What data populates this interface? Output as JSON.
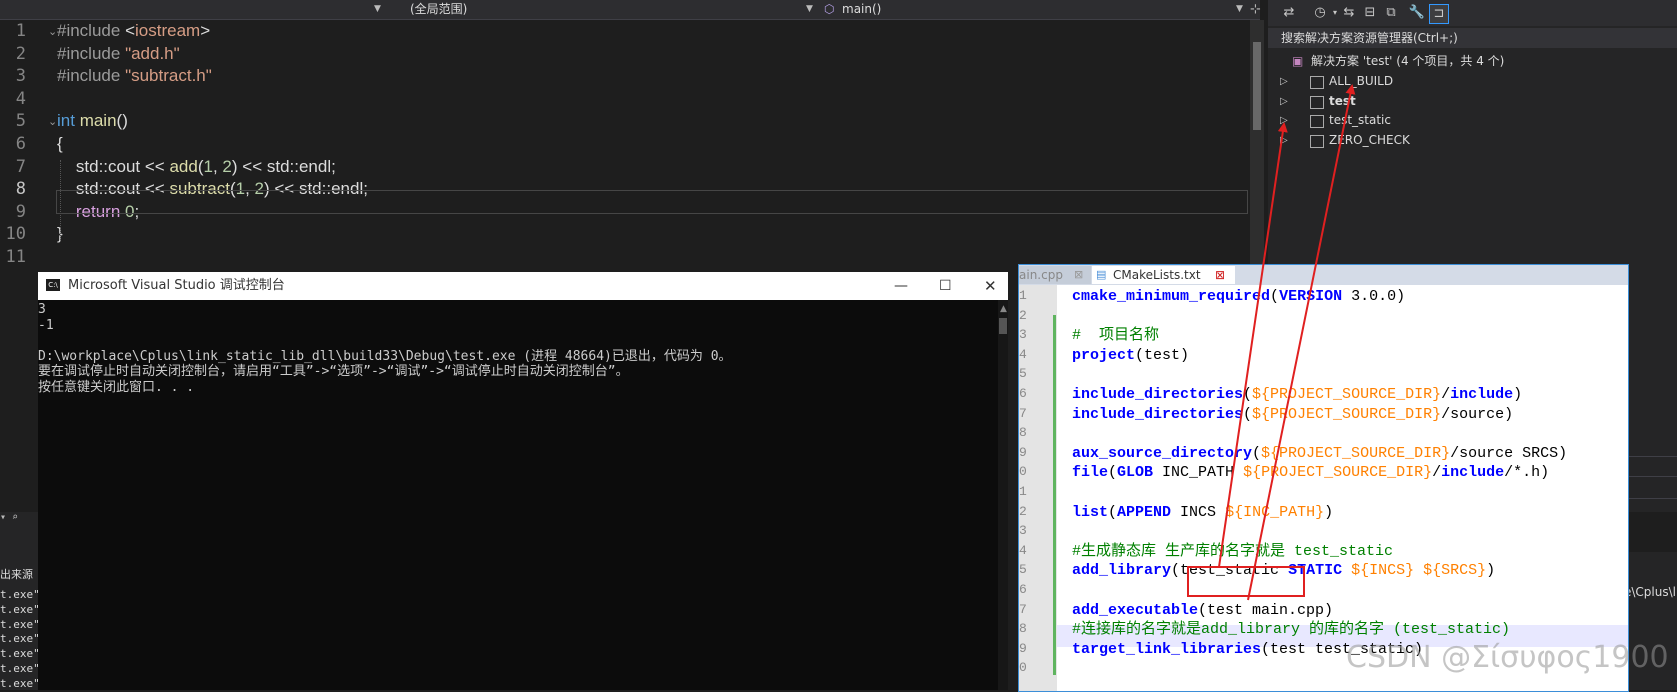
{
  "editor": {
    "nav": {
      "scope": "(全局范围)",
      "function": "main()"
    },
    "lines": [
      {
        "n": "1",
        "parts": [
          [
            "inc",
            "#include "
          ],
          [
            "txt",
            "<"
          ],
          [
            "str",
            "iostream"
          ],
          [
            "txt",
            ">"
          ]
        ]
      },
      {
        "n": "2",
        "parts": [
          [
            "inc",
            "#include "
          ],
          [
            "str",
            "\"add.h\""
          ]
        ]
      },
      {
        "n": "3",
        "parts": [
          [
            "inc",
            "#include "
          ],
          [
            "str",
            "\"subtract.h\""
          ]
        ]
      },
      {
        "n": "4",
        "parts": []
      },
      {
        "n": "5",
        "parts": [
          [
            "kw",
            "int "
          ],
          [
            "fn",
            "main"
          ],
          [
            "txt",
            "()"
          ]
        ]
      },
      {
        "n": "6",
        "parts": [
          [
            "txt",
            "{"
          ]
        ]
      },
      {
        "n": "7",
        "parts": [
          [
            "txt",
            "    std::cout << "
          ],
          [
            "fn",
            "add"
          ],
          [
            "txt",
            "("
          ],
          [
            "num",
            "1"
          ],
          [
            "txt",
            ", "
          ],
          [
            "num",
            "2"
          ],
          [
            "txt",
            ") << std::endl;"
          ]
        ]
      },
      {
        "n": "8",
        "parts": [
          [
            "txt",
            "    std::cout << "
          ],
          [
            "fn",
            "subtract"
          ],
          [
            "txt",
            "("
          ],
          [
            "num",
            "1"
          ],
          [
            "txt",
            ", "
          ],
          [
            "num",
            "2"
          ],
          [
            "txt",
            ") << std::endl;"
          ]
        ]
      },
      {
        "n": "9",
        "parts": [
          [
            "kw2",
            "    return "
          ],
          [
            "num",
            "0"
          ],
          [
            "txt",
            ";"
          ]
        ]
      },
      {
        "n": "10",
        "parts": [
          [
            "txt",
            "}"
          ]
        ]
      },
      {
        "n": "11",
        "parts": []
      }
    ]
  },
  "solution_explorer": {
    "search_placeholder": "搜索解决方案资源管理器(Ctrl+;)",
    "solution_label": "解决方案 'test' (4 个项目，共 4 个)",
    "projects": [
      "ALL_BUILD",
      "test",
      "test_static",
      "ZERO_CHECK"
    ],
    "right_fragment": "e\\Cplus\\li"
  },
  "console": {
    "title": "Microsoft Visual Studio 调试控制台",
    "output": [
      "3",
      "-1",
      "",
      "D:\\workplace\\Cplus\\link_static_lib_dll\\build33\\Debug\\test.exe (进程 48664)已退出，代码为 0。",
      "要在调试停止时自动关闭控制台，请启用“工具”->“选项”->“调试”->“调试停止时自动关闭控制台”。",
      "按任意键关闭此窗口. . ."
    ]
  },
  "notepad": {
    "tabs": [
      "ain.cpp",
      "CMakeLists.txt"
    ],
    "line_numbers": [
      "1",
      "2",
      "3",
      "4",
      "5",
      "6",
      "7",
      "8",
      "9",
      "0",
      "1",
      "2",
      "3",
      "4",
      "5",
      "6",
      "7",
      "8",
      "9",
      "0"
    ],
    "lines": [
      [
        [
          "kwb",
          "cmake_minimum_required"
        ],
        [
          "txt",
          "("
        ],
        [
          "kwb",
          "VERSION"
        ],
        [
          "txt",
          " 3.0.0)"
        ]
      ],
      [],
      [
        [
          "cm",
          "#  项目名称"
        ]
      ],
      [
        [
          "kwb",
          "project"
        ],
        [
          "txt",
          "(test)"
        ]
      ],
      [],
      [
        [
          "kwb",
          "include_directories"
        ],
        [
          "txt",
          "("
        ],
        [
          "var",
          "${PROJECT_SOURCE_DIR}"
        ],
        [
          "txt",
          "/"
        ],
        [
          "kwb",
          "include"
        ],
        [
          "txt",
          ")"
        ]
      ],
      [
        [
          "kwb",
          "include_directories"
        ],
        [
          "txt",
          "("
        ],
        [
          "var",
          "${PROJECT_SOURCE_DIR}"
        ],
        [
          "txt",
          "/source)"
        ]
      ],
      [],
      [
        [
          "kwb",
          "aux_source_directory"
        ],
        [
          "txt",
          "("
        ],
        [
          "var",
          "${PROJECT_SOURCE_DIR}"
        ],
        [
          "txt",
          "/source SRCS)"
        ]
      ],
      [
        [
          "kwb",
          "file"
        ],
        [
          "txt",
          "("
        ],
        [
          "kwb",
          "GLOB"
        ],
        [
          "txt",
          " INC_PATH "
        ],
        [
          "var",
          "${PROJECT_SOURCE_DIR}"
        ],
        [
          "txt",
          "/"
        ],
        [
          "kwb",
          "include"
        ],
        [
          "txt",
          "/*.h)"
        ]
      ],
      [],
      [
        [
          "kwb",
          "list"
        ],
        [
          "txt",
          "("
        ],
        [
          "kwb",
          "APPEND"
        ],
        [
          "txt",
          " INCS "
        ],
        [
          "var",
          "${INC_PATH}"
        ],
        [
          "txt",
          ")"
        ]
      ],
      [],
      [
        [
          "cm",
          "#生成静态库 生产库的名字就是 test_static"
        ]
      ],
      [
        [
          "kwb",
          "add_library"
        ],
        [
          "txt",
          "(test_static "
        ],
        [
          "kwb",
          "STATIC"
        ],
        [
          "txt",
          " "
        ],
        [
          "var",
          "${INCS} ${SRCS}"
        ],
        [
          "txt",
          ")"
        ]
      ],
      [],
      [
        [
          "kwb",
          "add_executable"
        ],
        [
          "txt",
          "(test main.cpp)"
        ]
      ],
      [
        [
          "cm",
          "#连接库的名字就是add_library 的库的名字 (test_static)"
        ]
      ],
      [
        [
          "kwb",
          "target_link_libraries"
        ],
        [
          "txt",
          "(test test_static)"
        ]
      ],
      []
    ]
  },
  "left_fragment": {
    "label": "出来源",
    "rows": [
      "t.exe\"",
      "t.exe\"",
      "t.exe\"",
      "t.exe\"",
      "t.exe\"",
      "t.exe\"",
      "t.exe\""
    ]
  },
  "watermark": "CSDN @Σίσυφος1900",
  "colors": {
    "annotation_red": "#e02020",
    "vs_background": "#1e1e1e",
    "npp_change_bar": "#5fb45f"
  }
}
